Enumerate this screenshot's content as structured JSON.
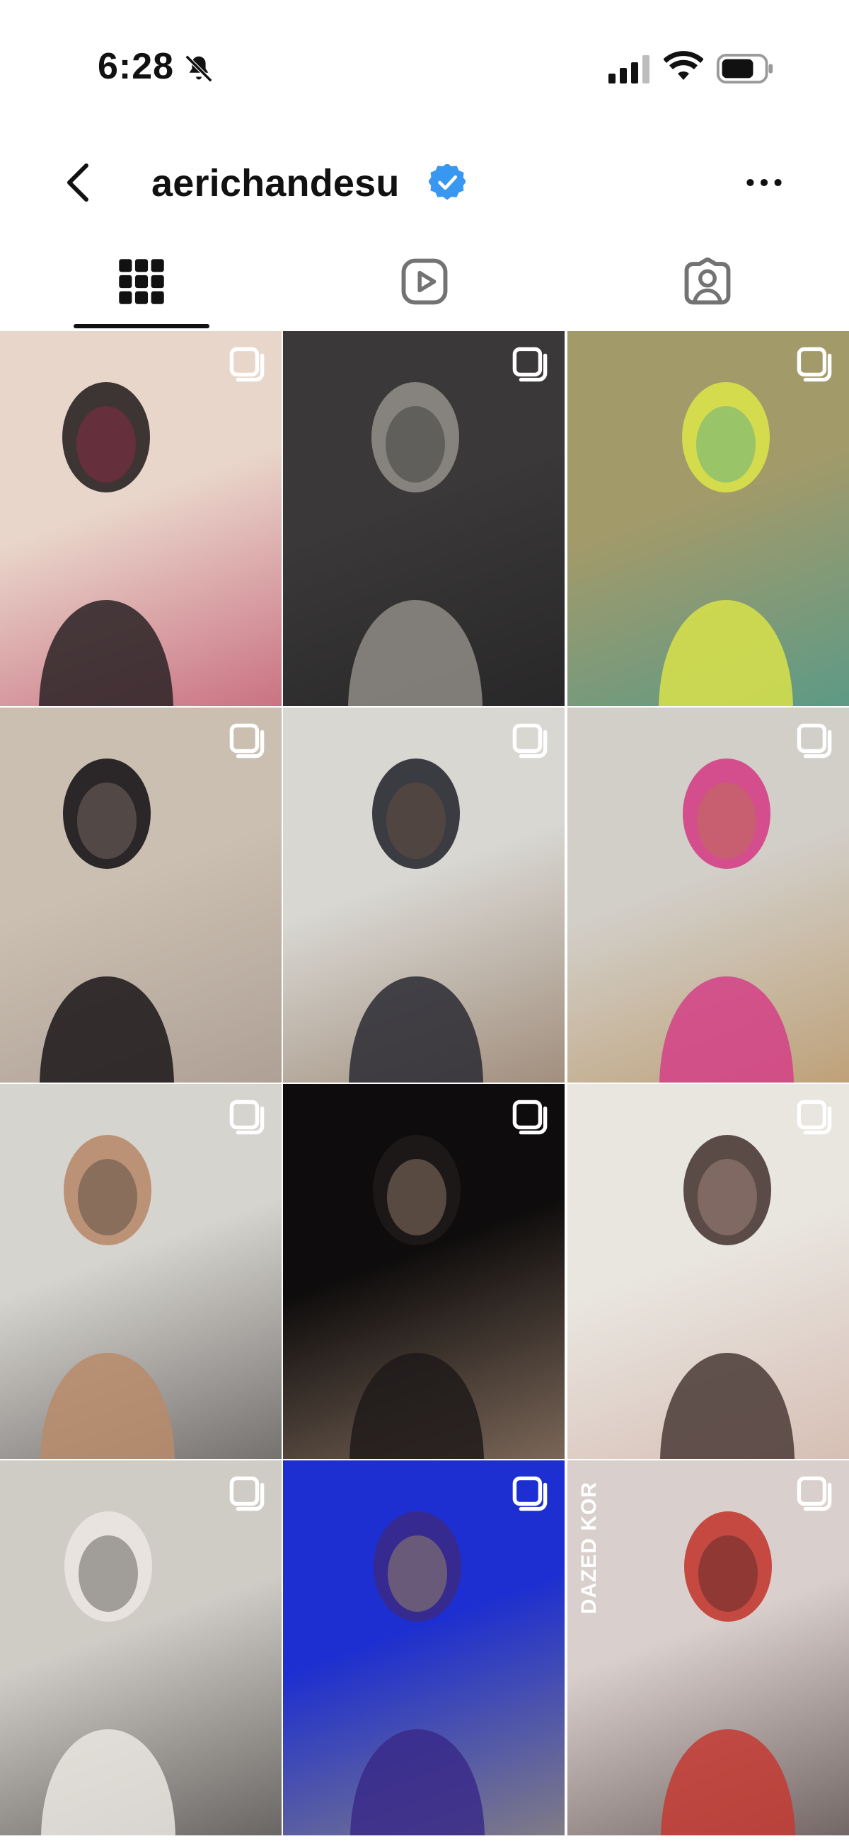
{
  "status_bar": {
    "time": "6:28",
    "icons": [
      "bell-slash-icon",
      "cellular-signal-icon",
      "wifi-icon",
      "battery-icon"
    ]
  },
  "header": {
    "username": "aerichandesu",
    "verified": true,
    "icons": [
      "chevron-left-icon",
      "verified-badge-icon",
      "more-horizontal-icon"
    ]
  },
  "tabs": [
    {
      "name": "posts",
      "icon": "grid-icon",
      "active": true
    },
    {
      "name": "reels",
      "icon": "reels-icon",
      "active": false
    },
    {
      "name": "tagged",
      "icon": "tagged-person-icon",
      "active": false
    }
  ],
  "posts": [
    {
      "type": "carousel",
      "icon": "multiple-photos-icon",
      "palette": [
        "#e9d6cb",
        "#2a2224",
        "#b3294e"
      ]
    },
    {
      "type": "carousel",
      "icon": "multiple-photos-icon",
      "palette": [
        "#3a3838",
        "#8f8c86",
        "#1c1c1e"
      ]
    },
    {
      "type": "carousel",
      "icon": "multiple-photos-icon",
      "palette": [
        "#a39a6a",
        "#d9e24a",
        "#2a9b9a"
      ]
    },
    {
      "type": "carousel",
      "icon": "multiple-photos-icon",
      "palette": [
        "#cbbfb2",
        "#1a1618",
        "#9a8a80"
      ]
    },
    {
      "type": "carousel",
      "icon": "multiple-photos-icon",
      "palette": [
        "#d8d7d2",
        "#2a2a32",
        "#7a5a40"
      ]
    },
    {
      "type": "carousel",
      "icon": "multiple-photos-icon",
      "palette": [
        "#d2cfc9",
        "#d43f86",
        "#b08040"
      ]
    },
    {
      "type": "carousel",
      "icon": "multiple-photos-icon",
      "palette": [
        "#d6d4cf",
        "#b88b6a",
        "#2e2a2a"
      ]
    },
    {
      "type": "carousel",
      "icon": "multiple-photos-icon",
      "palette": [
        "#0e0c0c",
        "#1f1a1a",
        "#c9a88f"
      ]
    },
    {
      "type": "carousel",
      "icon": "multiple-photos-icon",
      "palette": [
        "#e9e6e0",
        "#4a3a36",
        "#c9a396"
      ]
    },
    {
      "type": "carousel",
      "icon": "multiple-photos-icon",
      "palette": [
        "#cfccc6",
        "#eae6e0",
        "#1e1c1c"
      ]
    },
    {
      "type": "carousel",
      "icon": "multiple-photos-icon",
      "palette": [
        "#1d2fd0",
        "#3a2a8a",
        "#c9b44e"
      ]
    },
    {
      "type": "carousel",
      "icon": "multiple-photos-icon",
      "palette": [
        "#d9cfcc",
        "#c33a32",
        "#2a1a1c"
      ],
      "overlay_text": "DAZED KOR"
    }
  ]
}
